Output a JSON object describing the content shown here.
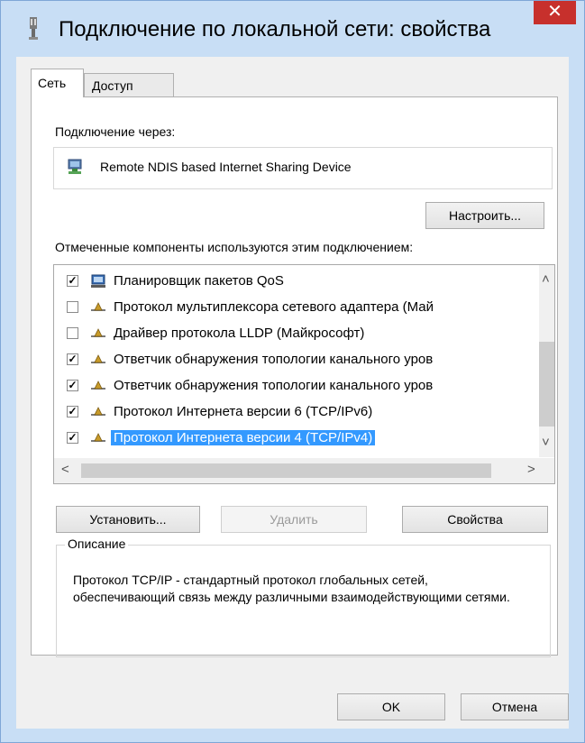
{
  "window": {
    "title": "Подключение по локальной сети: свойства",
    "close_label": "✕"
  },
  "tabs": [
    "Сеть",
    "Доступ"
  ],
  "panel": {
    "connect_via_label": "Подключение через:",
    "device_name": "Remote NDIS based Internet Sharing Device",
    "configure_label": "Настроить...",
    "components_label": "Отмеченные компоненты используются этим подключением:",
    "components": [
      {
        "label": "Планировщик пакетов QoS",
        "checked": true,
        "icon": "network-scheduler-icon"
      },
      {
        "label": "Протокол мультиплексора сетевого адаптера (Май",
        "checked": false,
        "icon": "network-protocol-icon"
      },
      {
        "label": "Драйвер протокола LLDP (Майкрософт)",
        "checked": false,
        "icon": "network-protocol-icon"
      },
      {
        "label": "Ответчик обнаружения топологии канального уров",
        "checked": true,
        "icon": "network-protocol-icon"
      },
      {
        "label": "Ответчик обнаружения топологии канального уров",
        "checked": true,
        "icon": "network-protocol-icon"
      },
      {
        "label": "Протокол Интернета версии 6 (TCP/IPv6)",
        "checked": true,
        "icon": "network-protocol-icon"
      },
      {
        "label": "Протокол Интернета версии 4 (TCP/IPv4)",
        "checked": true,
        "icon": "network-protocol-icon",
        "selected": true
      }
    ],
    "install_label": "Установить...",
    "remove_label": "Удалить",
    "properties_label": "Свойства",
    "description_title": "Описание",
    "description_text": "Протокол TCP/IP - стандартный протокол глобальных сетей, обеспечивающий связь между различными взаимодействующими сетями."
  },
  "footer": {
    "ok_label": "OK",
    "cancel_label": "Отмена"
  },
  "colors": {
    "title_bg": "#c8def5",
    "close_bg": "#c7302c",
    "selection": "#3399ff"
  }
}
